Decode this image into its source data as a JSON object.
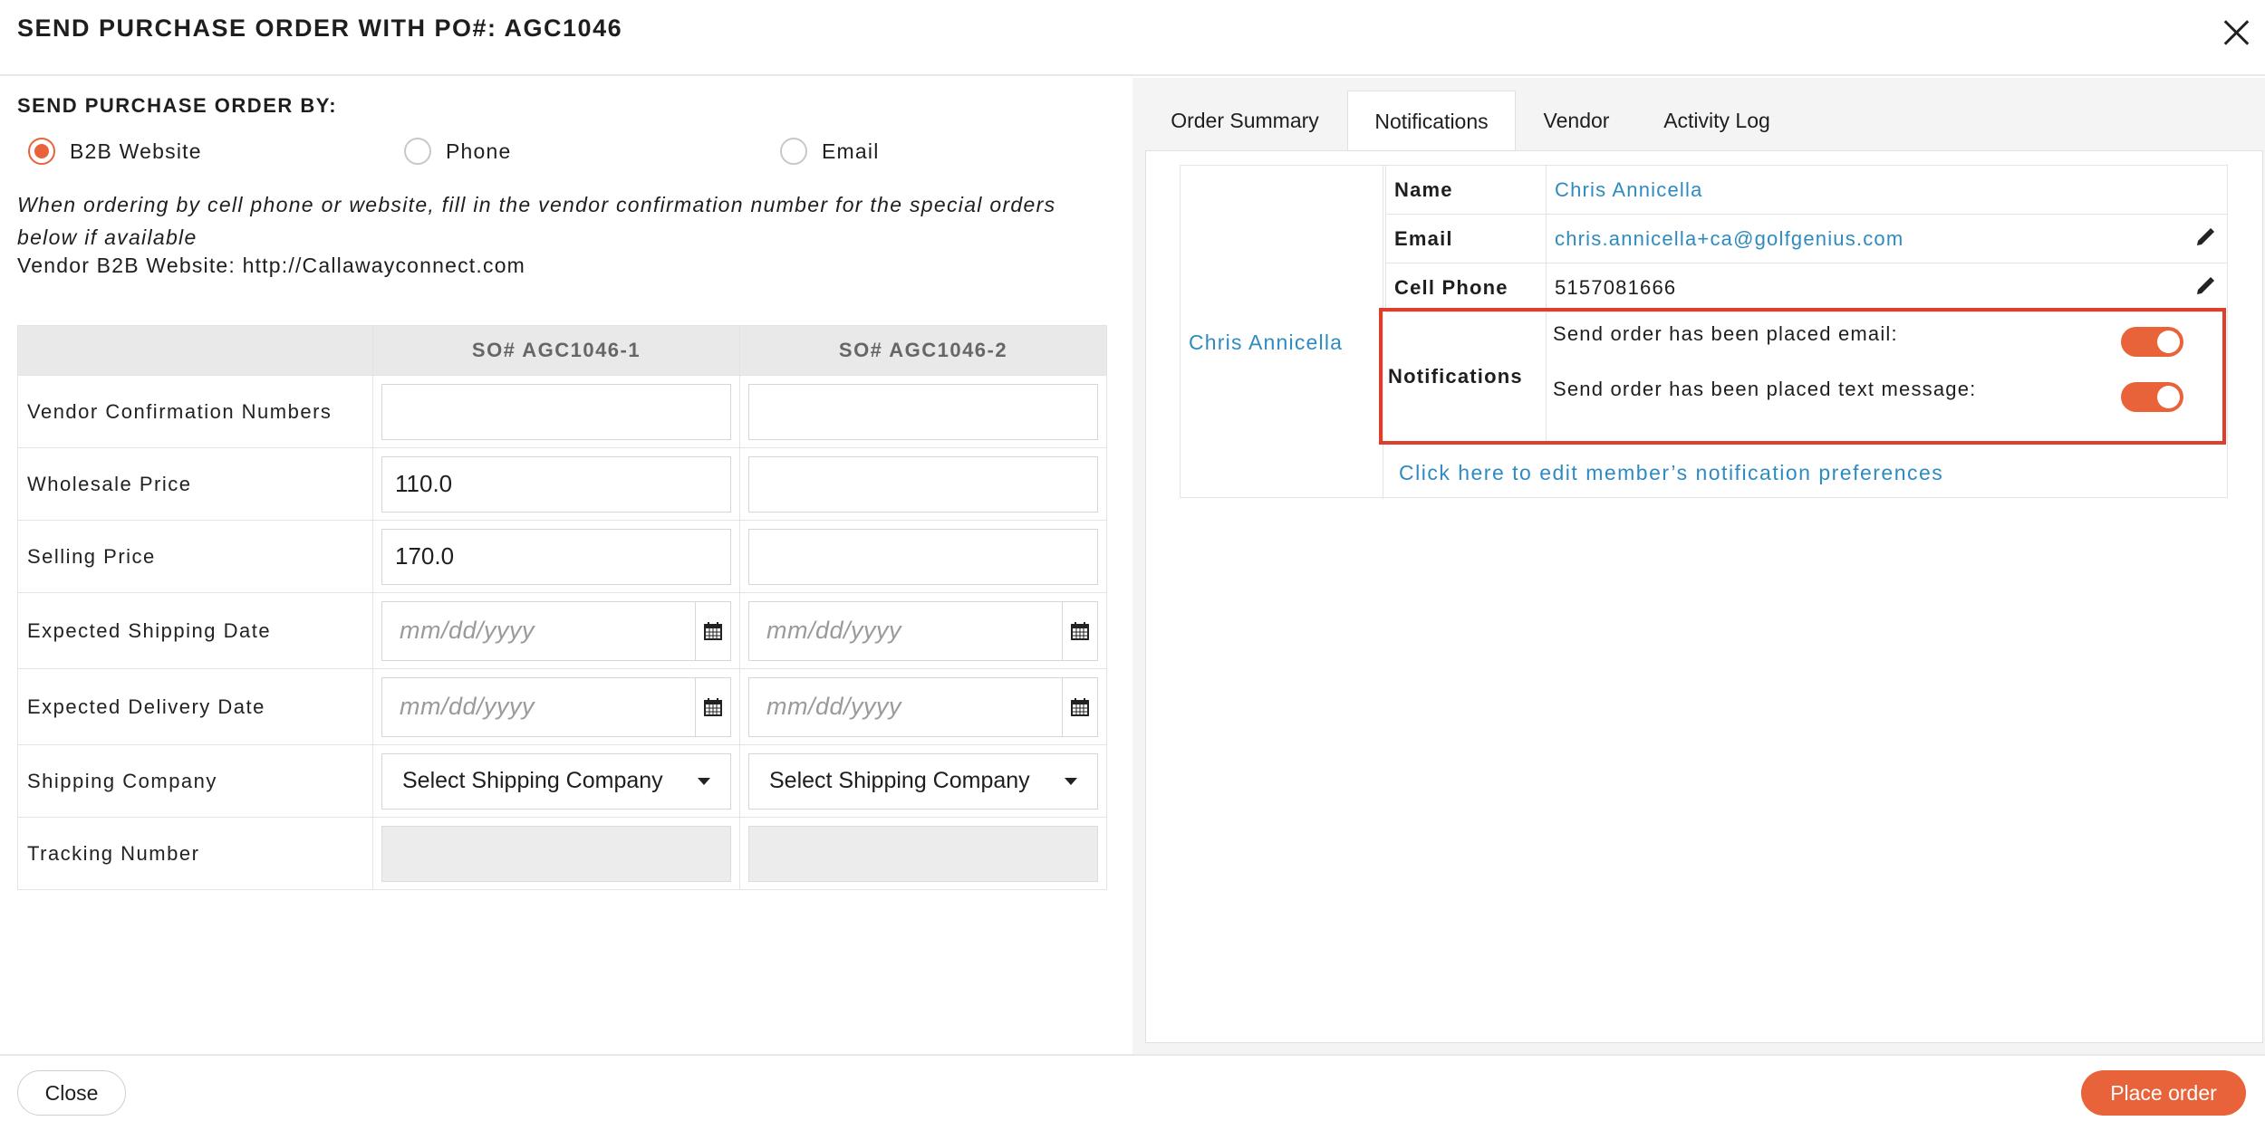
{
  "modal": {
    "title": "SEND PURCHASE ORDER WITH PO#: AGC1046"
  },
  "send_by": {
    "label": "SEND PURCHASE ORDER BY:",
    "options": [
      {
        "label": "B2B Website",
        "selected": true
      },
      {
        "label": "Phone",
        "selected": false
      },
      {
        "label": "Email",
        "selected": false
      }
    ],
    "hint": "When ordering by cell phone or website, fill in the vendor confirmation number for the special orders below if available",
    "vendor_site": "Vendor B2B Website: http://Callawayconnect.com"
  },
  "so_table": {
    "columns": [
      "SO# AGC1046-1",
      "SO# AGC1046-2"
    ],
    "rows": {
      "vendor_confirmation": {
        "label": "Vendor Confirmation Numbers",
        "values": [
          "",
          ""
        ]
      },
      "wholesale_price": {
        "label": "Wholesale Price",
        "values": [
          "110.0",
          ""
        ]
      },
      "selling_price": {
        "label": "Selling Price",
        "values": [
          "170.0",
          ""
        ]
      },
      "expected_shipping": {
        "label": "Expected Shipping Date",
        "placeholder": "mm/dd/yyyy"
      },
      "expected_delivery": {
        "label": "Expected Delivery Date",
        "placeholder": "mm/dd/yyyy"
      },
      "shipping_company": {
        "label": "Shipping Company",
        "selected": "Select Shipping Company"
      },
      "tracking_number": {
        "label": "Tracking Number",
        "values": [
          "",
          ""
        ]
      }
    }
  },
  "tabs": [
    {
      "label": "Order Summary",
      "active": false
    },
    {
      "label": "Notifications",
      "active": true
    },
    {
      "label": "Vendor",
      "active": false
    },
    {
      "label": "Activity Log",
      "active": false
    }
  ],
  "member": {
    "display_name": "Chris Annicella",
    "name_key": "Name",
    "name": "Chris Annicella",
    "email_key": "Email",
    "email": "chris.annicella+ca@golfgenius.com",
    "phone_key": "Cell Phone",
    "phone": "5157081666",
    "notifications_key": "Notifications",
    "notif_email": "Send order has been placed email:",
    "notif_email_on": true,
    "notif_text": "Send order has been placed text message:",
    "notif_text_on": true,
    "edit_prefs_link": "Click here to edit member’s notification preferences"
  },
  "icons": {
    "close": "close-icon",
    "calendar": "calendar-icon",
    "edit": "pencil-icon",
    "dropdown": "chevron-down-icon"
  },
  "colors": {
    "accent": "#e9633a",
    "link": "#2e8bc0",
    "highlight_border": "#e03e2d"
  },
  "footer": {
    "close_label": "Close",
    "place_order_label": "Place order"
  }
}
